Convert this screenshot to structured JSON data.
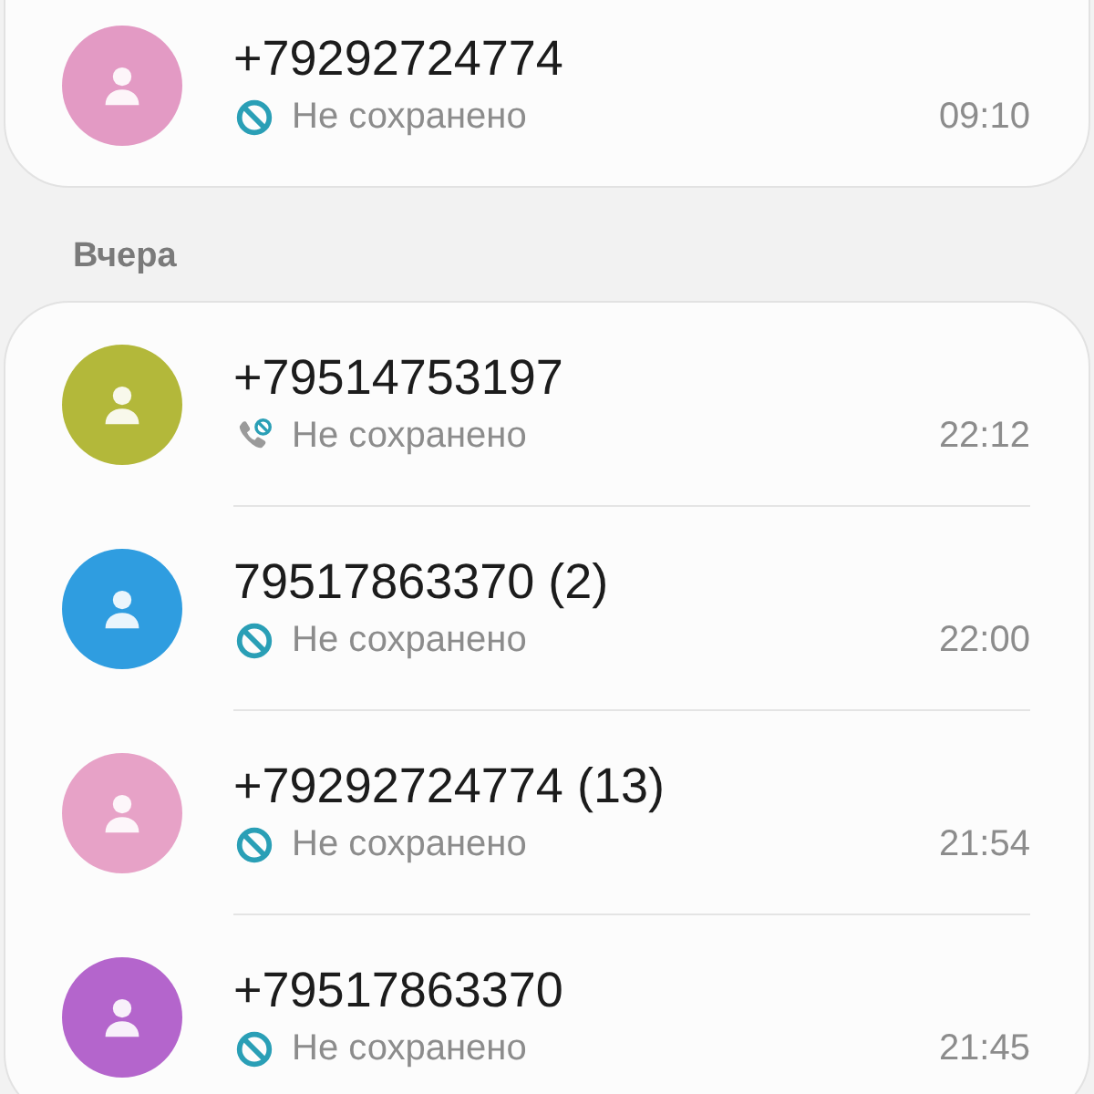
{
  "sections": [
    {
      "calls": [
        {
          "number": "+79292724774",
          "kind": "blocked",
          "status": "Не сохранено",
          "time": "09:10",
          "color": "#e39ac4"
        }
      ]
    },
    {
      "header": "Вчера",
      "calls": [
        {
          "number": "+79514753197",
          "kind": "call-blocked",
          "status": "Не сохранено",
          "time": "22:12",
          "color": "#b3b83a"
        },
        {
          "number": "79517863370 (2)",
          "kind": "blocked",
          "status": "Не сохранено",
          "time": "22:00",
          "color": "#2f9de0"
        },
        {
          "number": "+79292724774 (13)",
          "kind": "blocked",
          "status": "Не сохранено",
          "time": "21:54",
          "color": "#e7a2c7"
        },
        {
          "number": "+79517863370",
          "kind": "blocked",
          "status": "Не сохранено",
          "time": "21:45",
          "color": "#b465cc"
        }
      ]
    }
  ]
}
